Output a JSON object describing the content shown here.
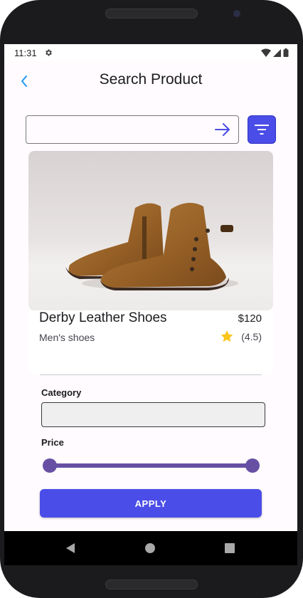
{
  "status_bar": {
    "time": "11:31",
    "icons": [
      "gear-icon",
      "wifi-icon",
      "signal-icon",
      "battery-icon"
    ]
  },
  "app_bar": {
    "title": "Search Product",
    "back_icon": "chevron-left-icon"
  },
  "search": {
    "value": "",
    "placeholder": "",
    "submit_icon": "arrow-right-icon",
    "filter_icon": "filter-icon"
  },
  "product": {
    "name": "Derby Leather Shoes",
    "price": "$120",
    "category": "Men's shoes",
    "rating": "(4.5)",
    "rating_icon": "star-icon"
  },
  "filter": {
    "category_label": "Category",
    "category_value": "",
    "price_label": "Price",
    "price_range": [
      0,
      1
    ],
    "apply_label": "APPLY"
  },
  "nav": {
    "icons": [
      "back-triangle-icon",
      "home-circle-icon",
      "recents-square-icon"
    ]
  },
  "colors": {
    "accent": "#4a4de7",
    "slider": "#6750a4",
    "back_arrow": "#2196f3",
    "star": "#f9c51a"
  }
}
